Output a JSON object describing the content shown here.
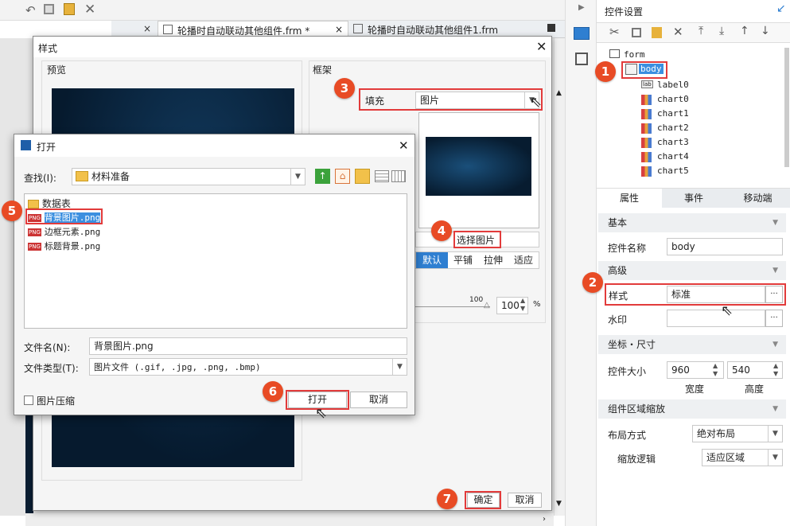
{
  "toolbar_top": {
    "icons": [
      "undo-icon",
      "copy-icon",
      "paste-icon",
      "delete-icon"
    ]
  },
  "tabs": [
    {
      "label": "轮播时自动联动其他组件.frm *",
      "close": "×"
    },
    {
      "label": "轮播时自动联动其他组件1.frm",
      "close": "×"
    }
  ],
  "right_panel": {
    "title": "控件设置",
    "tree": {
      "root": "form",
      "selected": "body",
      "children": [
        "label0",
        "chart0",
        "chart1",
        "chart2",
        "chart3",
        "chart4",
        "chart5"
      ]
    },
    "prop_tabs": [
      "属性",
      "事件",
      "移动端"
    ],
    "sections": {
      "basic": "基本",
      "advanced": "高级",
      "coords": "坐标・尺寸",
      "zoom": "组件区域缩放"
    },
    "name_label": "控件名称",
    "name_value": "body",
    "style_label": "样式",
    "style_value": "标准",
    "ellipsis": "···",
    "watermark_label": "水印",
    "size_label": "控件大小",
    "width": "960",
    "height": "540",
    "width_label": "宽度",
    "height_label": "高度",
    "layout_label": "布局方式",
    "layout_value": "绝对布局",
    "scale_label": "缩放逻辑",
    "scale_value": "适应区域"
  },
  "style_dialog": {
    "title": "样式",
    "preview_label": "预览",
    "frame_label": "框架",
    "fill_label": "填充",
    "fill_value": "图片",
    "choose_image": "选择图片",
    "modes": [
      "默认",
      "平铺",
      "拉伸",
      "适应"
    ],
    "opacity_tick": "100",
    "opacity_value": "100",
    "percent": "%",
    "ok": "确定",
    "cancel": "取消"
  },
  "open_dialog": {
    "title": "打开",
    "lookin_label": "查找(I):",
    "lookin_value": "材料准备",
    "files": [
      {
        "name": "数据表",
        "type": "folder"
      },
      {
        "name": "背景图片.png",
        "type": "png"
      },
      {
        "name": "边框元素.png",
        "type": "png"
      },
      {
        "name": "标题背景.png",
        "type": "png"
      }
    ],
    "filename_label": "文件名(N):",
    "filename_value": "背景图片.png",
    "filetype_label": "文件类型(T):",
    "filetype_value": "图片文件 (.gif, .jpg, .png, .bmp)",
    "compress_label": "图片压缩",
    "open": "打开",
    "cancel": "取消",
    "png_tag": "PNG"
  },
  "steps": [
    "1",
    "2",
    "3",
    "4",
    "5",
    "6",
    "7"
  ],
  "colors": {
    "accent": "#2f7fd1",
    "annotation": "#e23b3b",
    "badge": "#e84b25",
    "selected_bg": "#3b8fe0"
  }
}
